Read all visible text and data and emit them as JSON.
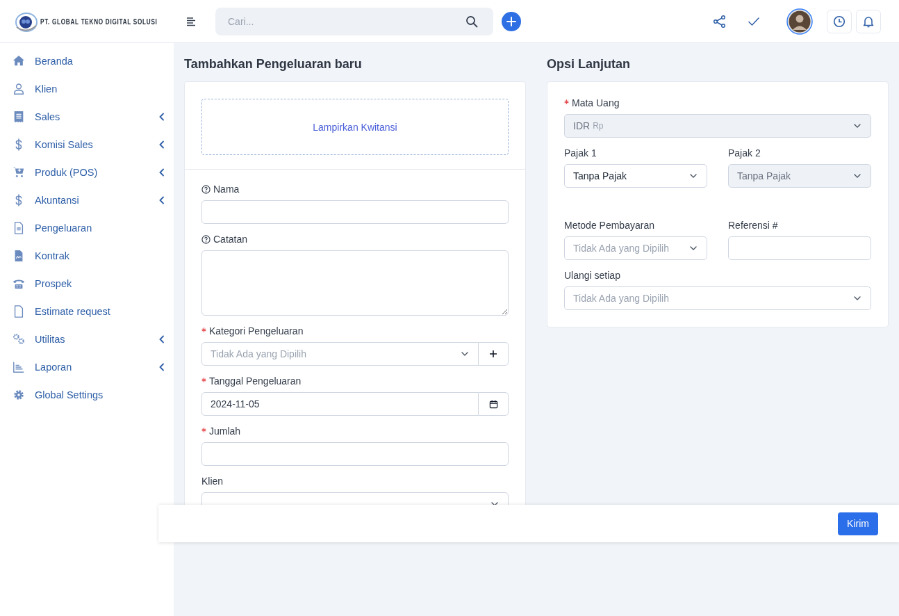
{
  "brand": {
    "name": "PT. GLOBAL TEKNO DIGITAL SOLUSI"
  },
  "topbar": {
    "search": {
      "placeholder": "Cari..."
    }
  },
  "sidebar": {
    "items": [
      {
        "label": "Beranda",
        "has_submenu": false
      },
      {
        "label": "Klien",
        "has_submenu": false
      },
      {
        "label": "Sales",
        "has_submenu": true
      },
      {
        "label": "Komisi Sales",
        "has_submenu": true
      },
      {
        "label": "Produk (POS)",
        "has_submenu": true
      },
      {
        "label": "Akuntansi",
        "has_submenu": true
      },
      {
        "label": "Pengeluaran",
        "has_submenu": false
      },
      {
        "label": "Kontrak",
        "has_submenu": false
      },
      {
        "label": "Prospek",
        "has_submenu": false
      },
      {
        "label": "Estimate request",
        "has_submenu": false
      },
      {
        "label": "Utilitas",
        "has_submenu": true
      },
      {
        "label": "Laporan",
        "has_submenu": true
      },
      {
        "label": "Global Settings",
        "has_submenu": false
      }
    ]
  },
  "expense_form": {
    "title": "Tambahkan Pengeluaran baru",
    "attachment": "Lampirkan Kwitansi",
    "fields": [
      {
        "kind": "input",
        "label": "Nama",
        "help": true,
        "required": false
      },
      {
        "kind": "textarea",
        "label": "Catatan",
        "help": true,
        "required": false
      },
      {
        "kind": "select-add",
        "label": "Kategori Pengeluaran",
        "help": false,
        "required": true,
        "placeholder": "Tidak Ada yang Dipilih"
      },
      {
        "kind": "date",
        "label": "Tanggal Pengeluaran",
        "help": false,
        "required": true,
        "value": "2024-11-05"
      },
      {
        "kind": "input",
        "label": "Jumlah",
        "help": false,
        "required": true
      },
      {
        "kind": "select",
        "label": "Klien",
        "help": false,
        "required": false
      }
    ]
  },
  "advanced_options": {
    "title": "Opsi Lanjutan",
    "rows": [
      [
        {
          "kind": "select",
          "label": "Mata Uang",
          "required": true,
          "disabled": true,
          "value": "IDR",
          "suffix": "Rp"
        }
      ],
      [
        {
          "kind": "select",
          "label": "Pajak 1",
          "required": false,
          "disabled": false,
          "value": "Tanpa Pajak"
        },
        {
          "kind": "select",
          "label": "Pajak 2",
          "required": false,
          "disabled": true,
          "value": "Tanpa Pajak"
        }
      ],
      [
        {
          "kind": "select",
          "label": "Metode Pembayaran",
          "required": false,
          "disabled": false,
          "placeholder": "Tidak Ada yang Dipilih"
        },
        {
          "kind": "input",
          "label": "Referensi #",
          "required": false,
          "disabled": false
        }
      ],
      [
        {
          "kind": "select",
          "label": "Ulangi setiap",
          "required": false,
          "disabled": false,
          "placeholder": "Tidak Ada yang Dipilih"
        }
      ]
    ]
  },
  "footer": {
    "submit": "Kirim"
  }
}
